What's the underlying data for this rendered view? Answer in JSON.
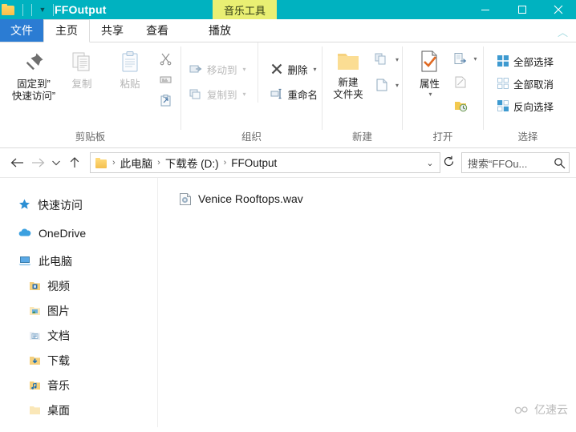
{
  "window": {
    "title": "FFOutput",
    "contextual_tool": "音乐工具",
    "minimize_label": "最小化",
    "maximize_label": "最大化",
    "close_label": "关闭",
    "titlebar_color": "#00b2c0",
    "contextual_color": "#e9ef73"
  },
  "tabs": [
    {
      "label": "文件",
      "state": "file"
    },
    {
      "label": "主页",
      "state": "active"
    },
    {
      "label": "共享",
      "state": "normal"
    },
    {
      "label": "查看",
      "state": "normal"
    },
    {
      "label": "播放",
      "state": "normal"
    }
  ],
  "ribbon": {
    "collapse_icon": "chevron-up-icon",
    "groups": [
      {
        "label": "剪贴板",
        "big_buttons": [
          {
            "label": "固定到“\n快速访问”",
            "line1": "固定到”",
            "line2": "快速访问”",
            "icon": "pin-icon",
            "disabled": false
          },
          {
            "label": "复制",
            "icon": "copy-icon",
            "disabled": true
          },
          {
            "label": "粘贴",
            "icon": "paste-icon",
            "disabled": true
          }
        ],
        "small_buttons": [
          {
            "label": "",
            "icon": "cut-scissors-icon",
            "disabled": true
          },
          {
            "label": "",
            "icon": "copy-path-icon",
            "disabled": true
          },
          {
            "label": "",
            "icon": "paste-shortcut-icon",
            "disabled": true
          }
        ]
      },
      {
        "label": "组织",
        "small_buttons": [
          {
            "label": "移动到",
            "icon": "move-to-icon",
            "caret": true,
            "disabled": true
          },
          {
            "label": "复制到",
            "icon": "copy-to-icon",
            "caret": true,
            "disabled": true
          },
          {
            "label": "删除",
            "icon": "delete-x-icon",
            "caret": true,
            "disabled": false
          },
          {
            "label": "重命名",
            "icon": "rename-icon",
            "caret": false,
            "disabled": false
          }
        ]
      },
      {
        "label": "新建",
        "big_buttons": [
          {
            "line1": "新建",
            "line2": "文件夹",
            "icon": "new-folder-icon",
            "disabled": false
          }
        ],
        "small_buttons": [
          {
            "label": "",
            "icon": "new-item-icon",
            "caret": true,
            "disabled": false
          },
          {
            "label": "",
            "icon": "easy-access-icon",
            "caret": true,
            "disabled": false
          }
        ]
      },
      {
        "label": "打开",
        "big_buttons": [
          {
            "line1": "属性",
            "line2": "",
            "icon": "properties-icon",
            "caret": true,
            "disabled": false
          }
        ],
        "small_buttons": [
          {
            "label": "",
            "icon": "open-with-icon",
            "caret": true,
            "disabled": false
          },
          {
            "label": "",
            "icon": "edit-icon",
            "caret": false,
            "disabled": true
          },
          {
            "label": "",
            "icon": "history-icon",
            "caret": false,
            "disabled": false
          }
        ]
      },
      {
        "label": "选择",
        "small_buttons": [
          {
            "label": "全部选择",
            "icon": "select-all-icon",
            "disabled": false
          },
          {
            "label": "全部取消",
            "icon": "select-none-icon",
            "disabled": false
          },
          {
            "label": "反向选择",
            "icon": "invert-selection-icon",
            "disabled": false
          }
        ]
      }
    ]
  },
  "addressbar": {
    "back_icon": "arrow-left-icon",
    "forward_icon": "arrow-right-icon",
    "recent_icon": "chevron-down-icon",
    "up_icon": "arrow-up-icon",
    "folder_icon": "folder-icon",
    "breadcrumbs": [
      "此电脑",
      "下载卷 (D:)",
      "FFOutput"
    ],
    "separator": "›",
    "dropdown_icon": "chevron-down-icon",
    "refresh_icon": "refresh-icon",
    "search_placeholder": "搜索“FFOu...",
    "search_icon": "search-icon"
  },
  "sidebar": {
    "items": [
      {
        "label": "快速访问",
        "icon": "star-pin-icon",
        "indent": false
      },
      {
        "label": "OneDrive",
        "icon": "cloud-icon",
        "indent": false
      },
      {
        "label": "此电脑",
        "icon": "computer-icon",
        "indent": false
      },
      {
        "label": "视频",
        "icon": "videos-folder-icon",
        "indent": true
      },
      {
        "label": "图片",
        "icon": "pictures-folder-icon",
        "indent": true
      },
      {
        "label": "文档",
        "icon": "documents-folder-icon",
        "indent": true
      },
      {
        "label": "下载",
        "icon": "downloads-folder-icon",
        "indent": true
      },
      {
        "label": "音乐",
        "icon": "music-folder-icon",
        "indent": true
      },
      {
        "label": "桌面",
        "icon": "desktop-folder-icon",
        "indent": true
      }
    ]
  },
  "content": {
    "files": [
      {
        "name": "Venice Rooftops.wav",
        "icon": "wav-media-file-icon"
      }
    ]
  },
  "watermark": {
    "text": "亿速云",
    "icon": "cloud-logo-icon"
  }
}
